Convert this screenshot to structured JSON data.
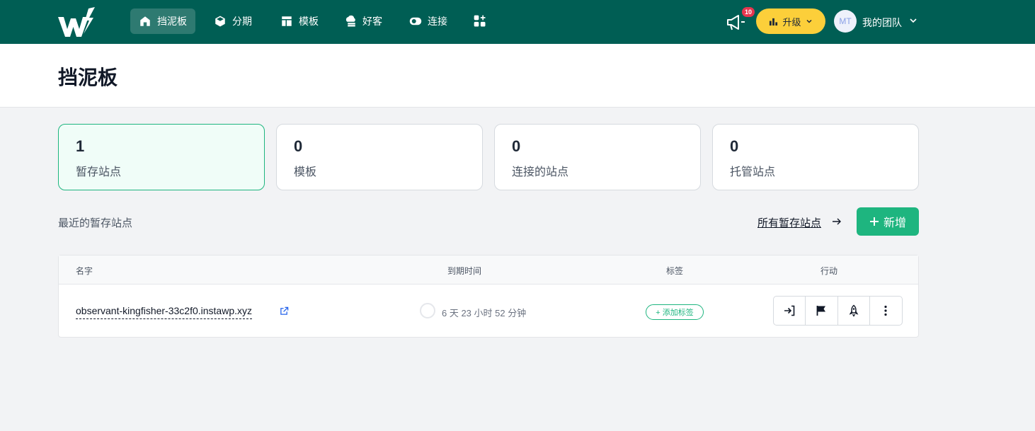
{
  "nav": {
    "items": [
      {
        "label": "挡泥板",
        "icon": "home-icon"
      },
      {
        "label": "分期",
        "icon": "cube-icon"
      },
      {
        "label": "模板",
        "icon": "template-icon"
      },
      {
        "label": "好客",
        "icon": "cloud-server-icon"
      },
      {
        "label": "连接",
        "icon": "connect-toggle-icon"
      }
    ],
    "apps_icon": "apps-plus-icon",
    "notifications": {
      "icon": "megaphone-icon",
      "count": "10"
    },
    "upgrade_label": "升级",
    "avatar_initials": "MT",
    "team_label": "我的团队"
  },
  "page": {
    "title": "挡泥板"
  },
  "stats": [
    {
      "count": "1",
      "label": "暂存站点"
    },
    {
      "count": "0",
      "label": "模板"
    },
    {
      "count": "0",
      "label": "连接的站点"
    },
    {
      "count": "0",
      "label": "托管站点"
    }
  ],
  "recent": {
    "label": "最近的暂存站点",
    "all_link": "所有暂存站点",
    "new_button": "新增"
  },
  "table": {
    "columns": [
      "名字",
      "到期时间",
      "标签",
      "行动"
    ],
    "rows": [
      {
        "name": "observant-kingfisher-33c2f0.instawp.xyz",
        "expiry": "6 天 23 小时 52 分钟",
        "tag_button": "+ 添加标签"
      }
    ]
  },
  "colors": {
    "nav_bg": "#005e54",
    "accent": "#1eb57f",
    "upgrade": "#fccf3a",
    "badge": "#e5364f"
  }
}
